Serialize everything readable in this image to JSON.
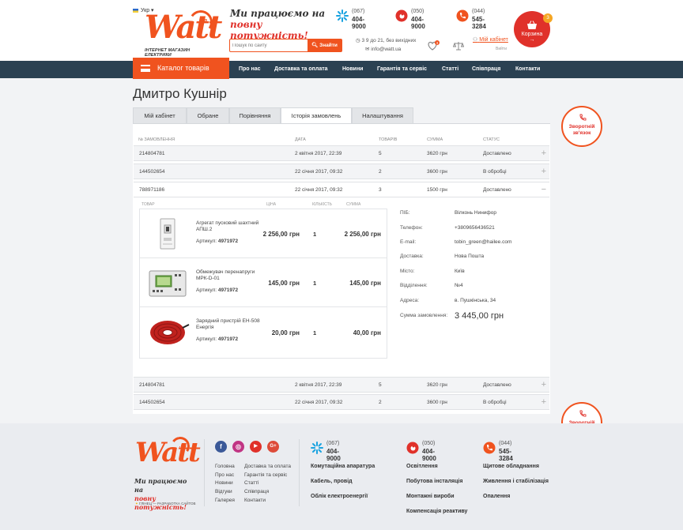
{
  "header": {
    "language": "Укр",
    "logo_text": "Watt",
    "logo_domain": ".ua",
    "logo_tagline": "ІНТЕРНЕТ МАГАЗИН ЕЛЕКТРИКИ",
    "slogan_line1": "Ми працюємо на",
    "slogan_line2": "повну потужність!",
    "search_placeholder": "Пошук по сайту",
    "search_button": "Знайти",
    "phones": [
      {
        "operator": "kyivstar",
        "code": "(067)",
        "number": "404-9000",
        "color": "#1aa3e0"
      },
      {
        "operator": "vodafone",
        "code": "(050)",
        "number": "404-9000",
        "color": "#e0312a"
      },
      {
        "operator": "landline",
        "code": "(044)",
        "number": "545-3284",
        "color": "#f0531f"
      }
    ],
    "hours": "3 9 до 21, без вихідних",
    "email": "info@watt.ua",
    "wishlist_count": "3",
    "cabinet_link": "Мій кабінет",
    "logout_link": "Вийти",
    "cart_label": "Корзина",
    "cart_arrow": "→",
    "cart_count": "3"
  },
  "nav": {
    "catalog": "Каталог товарів",
    "items": [
      "Про нас",
      "Доставка та оплата",
      "Новини",
      "Гарантія та сервіс",
      "Статті",
      "Співпраця",
      "Контакти"
    ]
  },
  "page": {
    "title": "Дмитро Кушнір",
    "tabs": [
      "Мій кабінет",
      "Обране",
      "Порівняння",
      "Історія замовлень",
      "Налаштування"
    ],
    "active_tab": "Історія замовлень"
  },
  "orders": {
    "headers": [
      "№ замовлення",
      "Дата",
      "Товарів",
      "Сумма",
      "Статус"
    ],
    "rows": [
      {
        "id": "214804781",
        "date": "2 квітня 2017, 22:39",
        "count": "5",
        "sum": "3620 грн",
        "status": "Доставлено",
        "toggle": "+"
      },
      {
        "id": "144502654",
        "date": "22 січня 2017, 09:32",
        "count": "2",
        "sum": "3600 грн",
        "status": "В обробці",
        "toggle": "+"
      },
      {
        "id": "788971186",
        "date": "22 січня 2017, 09:32",
        "count": "3",
        "sum": "1500 грн",
        "status": "Доставлено",
        "toggle": "−"
      },
      {
        "id": "214804781",
        "date": "2 квітня 2017, 22:39",
        "count": "5",
        "sum": "3620 грн",
        "status": "Доставлено",
        "toggle": "+"
      },
      {
        "id": "144502654",
        "date": "22 січня 2017, 09:32",
        "count": "2",
        "sum": "3600 грн",
        "status": "В обробці",
        "toggle": "+"
      }
    ]
  },
  "detail": {
    "headers": [
      "Товар",
      "Ціна",
      "Кількість",
      "Сумма"
    ],
    "article_label": "Артикул:",
    "items": [
      {
        "name": "Агрегат пусковий шахтний АПШ.2",
        "article": "4971972",
        "price": "2 256,00 грн",
        "qty": "1",
        "sum": "2 256,00 грн"
      },
      {
        "name": "Обмежувач перенапруги МРК-D-01",
        "article": "4971972",
        "price": "145,00 грн",
        "qty": "1",
        "sum": "145,00 грн"
      },
      {
        "name": "Зарядний пристрій ЕН-508 Енергія",
        "article": "4971972",
        "price": "20,00 грн",
        "qty": "1",
        "sum": "40,00 грн"
      }
    ],
    "info": [
      {
        "label": "ПІБ:",
        "value": "Вілконь Нинифор"
      },
      {
        "label": "Телефон:",
        "value": "+3809656436521"
      },
      {
        "label": "E-mail:",
        "value": "tobin_green@hailee.com"
      },
      {
        "label": "Доставка:",
        "value": "Нова Пошта"
      },
      {
        "label": "Місто:",
        "value": "Київ"
      },
      {
        "label": "Відділення:",
        "value": "№4"
      },
      {
        "label": "Адреса:",
        "value": "в. Пушкінська, 34"
      }
    ],
    "total_label": "Сумма замовлення:",
    "total_value": "3 445,00 грн"
  },
  "callback": {
    "line1": "Зворотній",
    "line2": "зв'язок"
  },
  "footer": {
    "logo_text": "Watt",
    "logo_domain": ".ua",
    "slogan_line1": "Ми працюємо на",
    "slogan_line2": "повну потужність!",
    "developer": "ГЛІНЕЦ — РАЗРАБОТКА САЙТОВ",
    "social": [
      {
        "name": "facebook",
        "glyph": "f",
        "color": "#3b5998"
      },
      {
        "name": "instagram",
        "glyph": "◎",
        "color": "#c13584"
      },
      {
        "name": "youtube",
        "glyph": "▶",
        "color": "#e0312a"
      },
      {
        "name": "google-plus",
        "glyph": "G+",
        "color": "#dd4b39"
      }
    ],
    "links_col1": [
      "Головна",
      "Про нас",
      "Новини",
      "Відгуки",
      "Галерея"
    ],
    "links_col2": [
      "Доставка та оплата",
      "Гарантія та сервіс",
      "Статті",
      "Співпраця",
      "Контакти"
    ],
    "phones": [
      {
        "code": "(067)",
        "number": "404-9000"
      },
      {
        "code": "(050)",
        "number": "404-9000"
      },
      {
        "code": "(044)",
        "number": "545-3284"
      }
    ],
    "cat_col1": [
      "Комутаційна апаратура",
      "Кабель, провід",
      "Облік електроенергії"
    ],
    "cat_col2": [
      "Освітлення",
      "Побутова інсталяція",
      "Монтажні вироби",
      "Компенсація реактиву"
    ],
    "cat_col3": [
      "Щитове обладнання",
      "Живлення і стабілізація",
      "Опалення"
    ]
  },
  "colors": {
    "accent": "#f0531f",
    "red": "#e0312a",
    "nav": "#2b4152"
  }
}
